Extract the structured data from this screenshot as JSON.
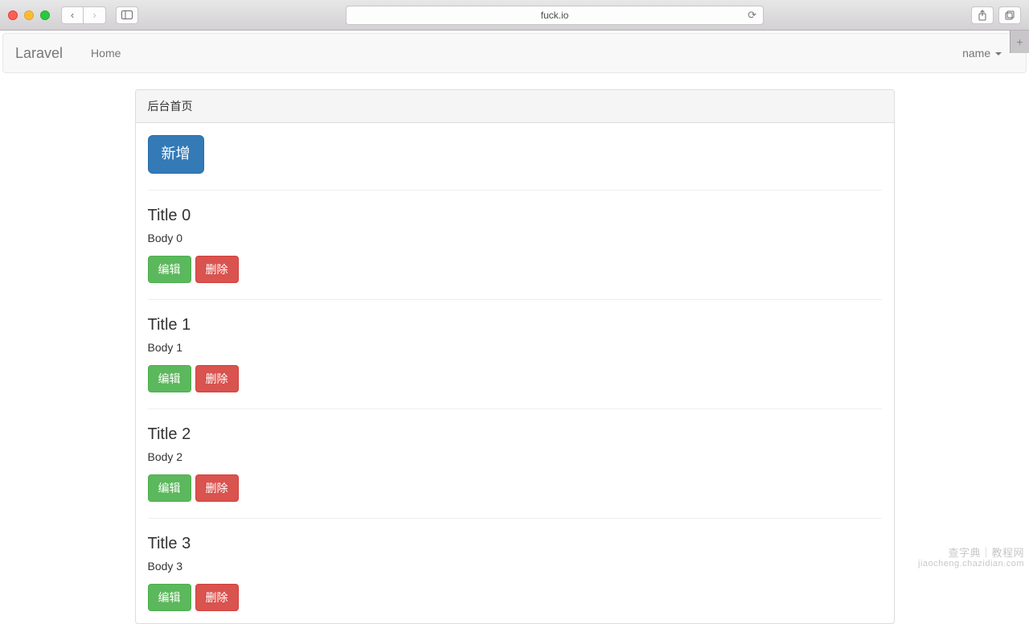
{
  "browser": {
    "url": "fuck.io"
  },
  "navbar": {
    "brand": "Laravel",
    "home_label": "Home",
    "user_label": "name"
  },
  "panel": {
    "heading": "后台首页",
    "add_button": "新增"
  },
  "labels": {
    "edit": "编辑",
    "delete": "删除"
  },
  "articles": [
    {
      "title": "Title 0",
      "body": "Body 0"
    },
    {
      "title": "Title 1",
      "body": "Body 1"
    },
    {
      "title": "Title 2",
      "body": "Body 2"
    },
    {
      "title": "Title 3",
      "body": "Body 3"
    }
  ],
  "watermark": {
    "cn": "查字典｜教程网",
    "en": "jiaocheng.chazidian.com"
  }
}
